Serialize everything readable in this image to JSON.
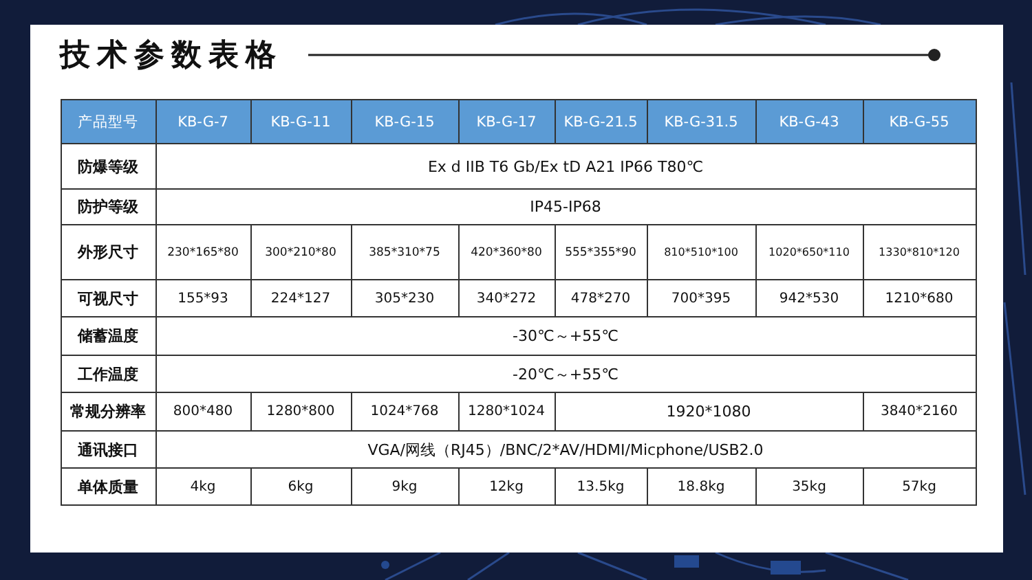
{
  "title": "技术参数表格",
  "table": {
    "columns": [
      "产品型号",
      "KB-G-7",
      "KB-G-11",
      "KB-G-15",
      "KB-G-17",
      "KB-G-21.5",
      "KB-G-31.5",
      "KB-G-43",
      "KB-G-55"
    ],
    "rows": [
      {
        "cells": [
          "防爆等级",
          "Ex d IIB T6 Gb/Ex tD A21 IP66 T80℃",
          null,
          null,
          null,
          null,
          null,
          null,
          null
        ]
      },
      {
        "cells": [
          "防护等级",
          "IP45-IP68",
          null,
          null,
          null,
          null,
          null,
          null,
          null
        ]
      },
      {
        "cells": [
          "外形尺寸",
          "230*165*80",
          "300*210*80",
          "385*310*75",
          "420*360*80",
          "555*355*90",
          "810*510*100",
          "1020*650*110",
          "1330*810*120"
        ]
      },
      {
        "cells": [
          "可视尺寸",
          "155*93",
          "224*127",
          "305*230",
          "340*272",
          "478*270",
          "700*395",
          "942*530",
          "1210*680"
        ]
      },
      {
        "cells": [
          "储蓄温度",
          "-30℃～+55℃",
          null,
          null,
          null,
          null,
          null,
          null,
          null
        ]
      },
      {
        "cells": [
          "工作温度",
          "-20℃～+55℃",
          null,
          null,
          null,
          null,
          null,
          null,
          null
        ]
      },
      {
        "cells": [
          "常规分辨率",
          "800*480",
          "1280*800",
          "1024*768",
          "1280*1024",
          "",
          "1920*1080",
          "",
          "3840*2160"
        ]
      },
      {
        "cells": [
          "通讯接口",
          "VGA/网线（RJ45）/BNC/2*AV/HDMI/Micphone/USB2.0",
          null,
          null,
          null,
          null,
          null,
          null,
          null
        ]
      },
      {
        "cells": [
          "单体质量",
          "4kg",
          "6kg",
          "9kg",
          "12kg",
          "13.5kg",
          "18.8kg",
          "35kg",
          "57kg"
        ]
      }
    ]
  }
}
